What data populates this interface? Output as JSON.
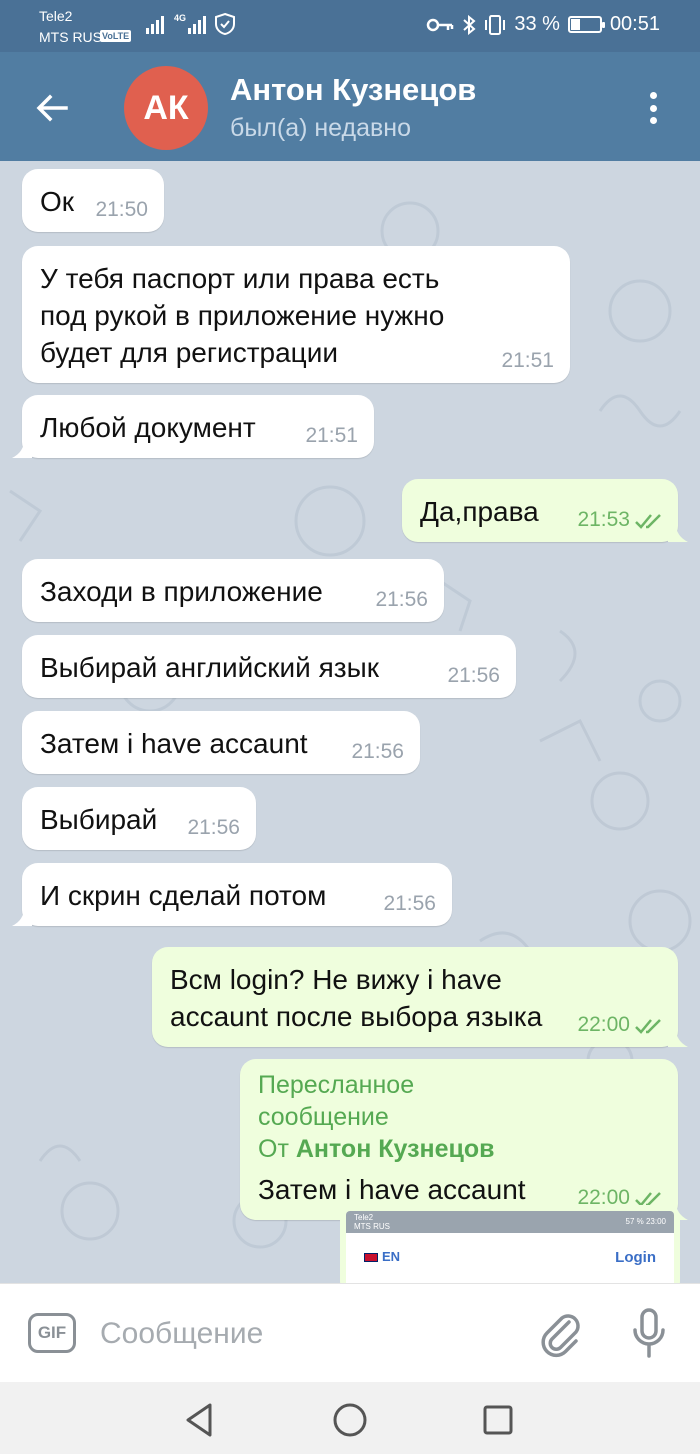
{
  "status_bar": {
    "carrier1": "Tele2",
    "carrier2": "MTS RUS",
    "volte": "VoLTE",
    "network": "4G",
    "battery_percent": "33 %",
    "battery_level": 0.33,
    "time": "00:51"
  },
  "header": {
    "avatar_initials": "АК",
    "avatar_color": "#e0604f",
    "name": "Антон Кузнецов",
    "status": "был(а) недавно"
  },
  "messages": [
    {
      "dir": "in",
      "text": "Ок",
      "time": "21:50"
    },
    {
      "dir": "in",
      "text": "У тебя паспорт или права есть под рукой в приложение нужно будет для регистрации",
      "time": "21:51"
    },
    {
      "dir": "in",
      "text": "Любой документ",
      "time": "21:51"
    },
    {
      "dir": "out",
      "text": "Да,права",
      "time": "21:53",
      "read": true
    },
    {
      "dir": "in",
      "text": "Заходи в приложение",
      "time": "21:56"
    },
    {
      "dir": "in",
      "text": "Выбирай английский язык",
      "time": "21:56"
    },
    {
      "dir": "in",
      "text": "Затем i have accaunt",
      "time": "21:56"
    },
    {
      "dir": "in",
      "text": "Выбирай",
      "time": "21:56"
    },
    {
      "dir": "in",
      "text": "И скрин сделай потом",
      "time": "21:56"
    },
    {
      "dir": "out",
      "text": "Всм login? Не вижу i have accaunt после выбора языка",
      "time": "22:00",
      "read": true
    },
    {
      "dir": "out",
      "forwarded_label": "Пересланное сообщение",
      "forwarded_from_prefix": "От",
      "forwarded_from": "Антон Кузнецов",
      "text": "Затем i have accaunt",
      "time": "22:00",
      "read": true
    }
  ],
  "screenshot_preview": {
    "carrier": "Tele2",
    "carrier2": "MTS RUS",
    "status_right": "57 % 23:00",
    "language": "EN",
    "login": "Login"
  },
  "input": {
    "gif_label": "GIF",
    "placeholder": "Сообщение"
  },
  "colors": {
    "header": "#517da2",
    "outgoing_bubble": "#effedd",
    "incoming_bubble": "#ffffff",
    "check_color": "#6db565"
  }
}
